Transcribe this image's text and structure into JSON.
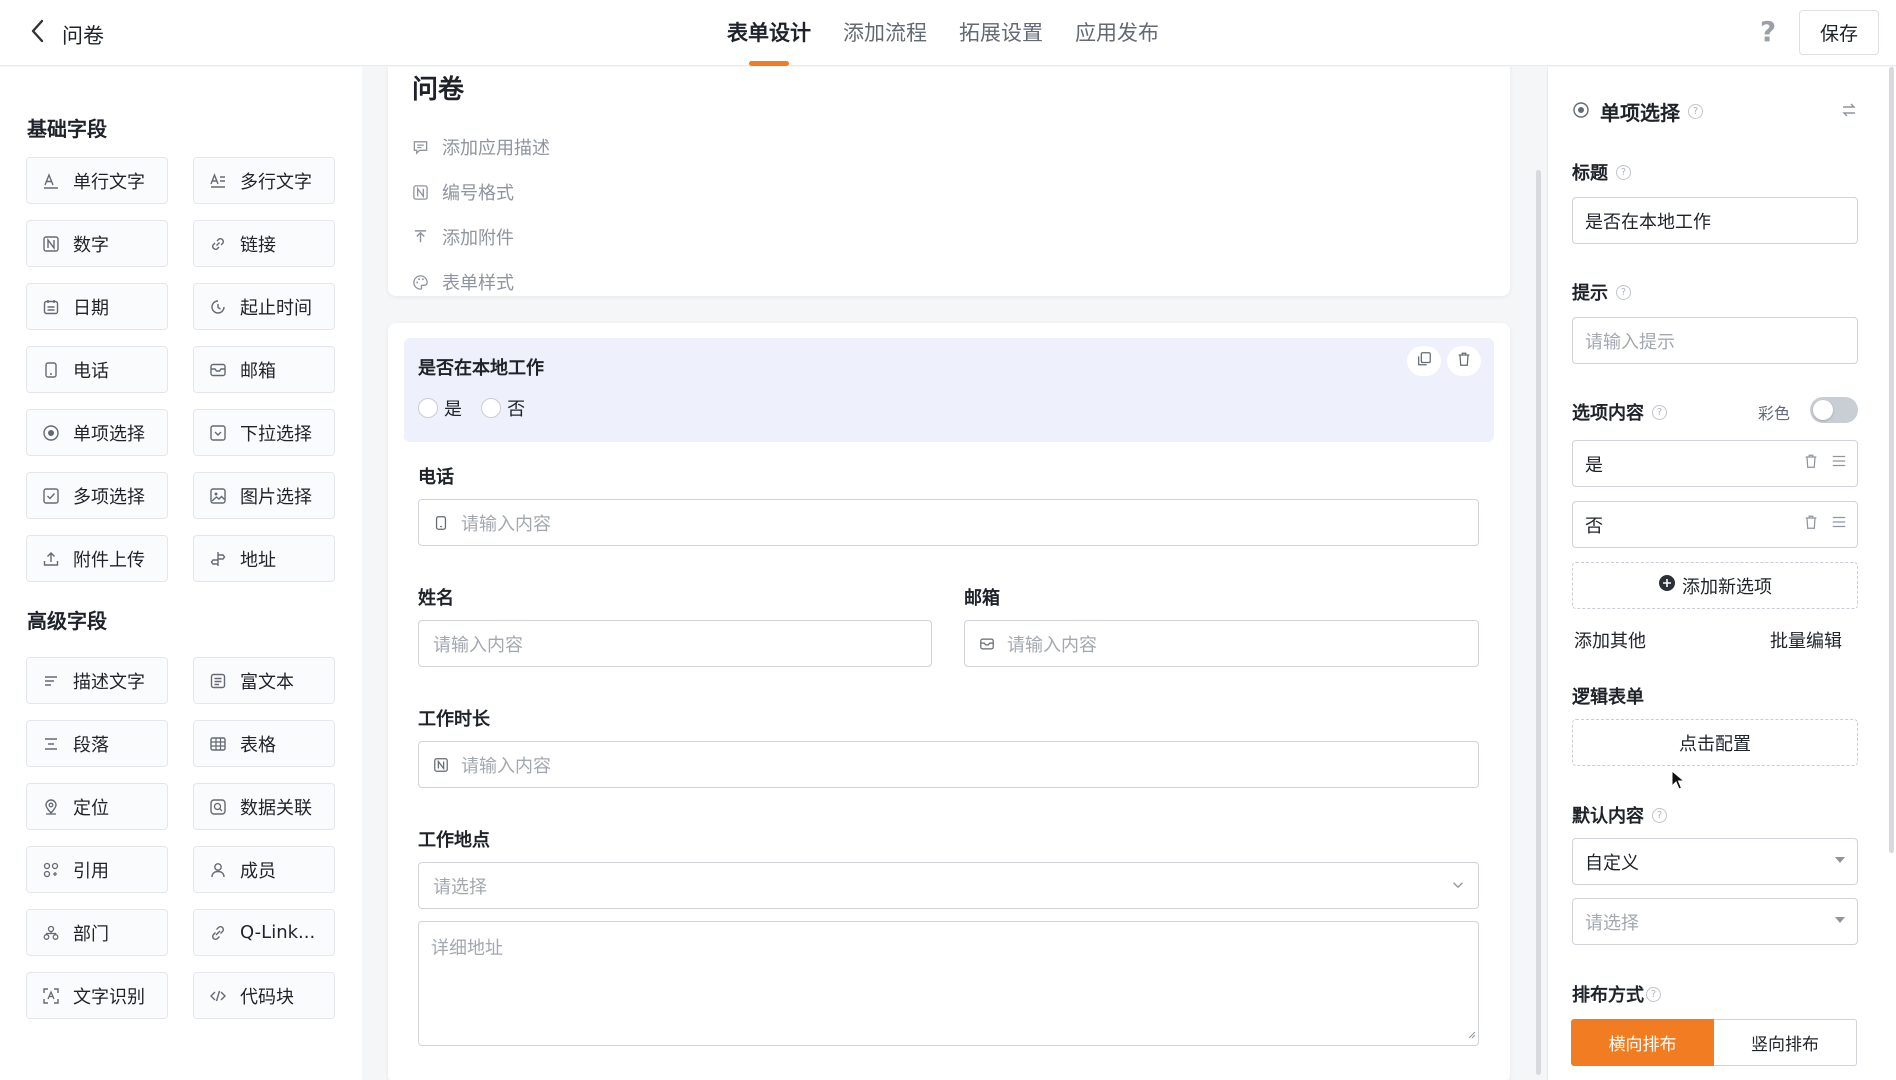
{
  "header": {
    "back_icon": "chevron-left-icon",
    "title": "问卷",
    "tabs": [
      {
        "label": "表单设计",
        "active": true
      },
      {
        "label": "添加流程",
        "active": false
      },
      {
        "label": "拓展设置",
        "active": false
      },
      {
        "label": "应用发布",
        "active": false
      }
    ],
    "help_label": "?",
    "save_label": "保存",
    "accent_color": "#f27c22"
  },
  "left_panel": {
    "basic_title": "基础字段",
    "basic_fields": [
      {
        "label": "单行文字",
        "icon": "text-line-icon"
      },
      {
        "label": "多行文字",
        "icon": "text-multi-icon"
      },
      {
        "label": "数字",
        "icon": "number-icon"
      },
      {
        "label": "链接",
        "icon": "link-icon"
      },
      {
        "label": "日期",
        "icon": "calendar-icon"
      },
      {
        "label": "起止时间",
        "icon": "time-range-icon"
      },
      {
        "label": "电话",
        "icon": "phone-icon"
      },
      {
        "label": "邮箱",
        "icon": "mail-icon"
      },
      {
        "label": "单项选择",
        "icon": "radio-icon"
      },
      {
        "label": "下拉选择",
        "icon": "dropdown-icon"
      },
      {
        "label": "多项选择",
        "icon": "checkbox-icon"
      },
      {
        "label": "图片选择",
        "icon": "image-icon"
      },
      {
        "label": "附件上传",
        "icon": "upload-icon"
      },
      {
        "label": "地址",
        "icon": "address-icon"
      }
    ],
    "advanced_title": "高级字段",
    "advanced_fields": [
      {
        "label": "描述文字",
        "icon": "description-icon"
      },
      {
        "label": "富文本",
        "icon": "rich-text-icon"
      },
      {
        "label": "段落",
        "icon": "paragraph-icon"
      },
      {
        "label": "表格",
        "icon": "table-icon"
      },
      {
        "label": "定位",
        "icon": "location-icon"
      },
      {
        "label": "数据关联",
        "icon": "data-link-icon"
      },
      {
        "label": "引用",
        "icon": "reference-icon"
      },
      {
        "label": "成员",
        "icon": "member-icon"
      },
      {
        "label": "部门",
        "icon": "department-icon"
      },
      {
        "label": "Q-Link...",
        "icon": "qlink-icon"
      },
      {
        "label": "文字识别",
        "icon": "ocr-icon"
      },
      {
        "label": "代码块",
        "icon": "code-icon"
      }
    ]
  },
  "canvas": {
    "form_name": "问卷",
    "meta_items": [
      {
        "label": "添加应用描述",
        "icon": "comment-icon"
      },
      {
        "label": "编号格式",
        "icon": "number-format-icon"
      },
      {
        "label": "添加附件",
        "icon": "attach-icon"
      },
      {
        "label": "表单样式",
        "icon": "palette-icon"
      }
    ],
    "selected_question": {
      "title": "是否在本地工作",
      "options": [
        "是",
        "否"
      ]
    },
    "phone": {
      "label": "电话",
      "placeholder": "请输入内容"
    },
    "name": {
      "label": "姓名",
      "placeholder": "请输入内容"
    },
    "email": {
      "label": "邮箱",
      "placeholder": "请输入内容"
    },
    "work_duration": {
      "label": "工作时长",
      "placeholder": "请输入内容"
    },
    "work_location": {
      "label": "工作地点",
      "select_placeholder": "请选择",
      "detail_placeholder": "详细地址"
    }
  },
  "right_panel": {
    "component_name": "单项选择",
    "title_label": "标题",
    "title_value": "是否在本地工作",
    "hint_label": "提示",
    "hint_placeholder": "请输入提示",
    "options_label": "选项内容",
    "color_label": "彩色",
    "color_enabled": false,
    "options": [
      "是",
      "否"
    ],
    "add_option_label": "添加新选项",
    "add_other_label": "添加其他",
    "bulk_edit_label": "批量编辑",
    "logic_label": "逻辑表单",
    "logic_button": "点击配置",
    "default_label": "默认内容",
    "default_mode": "自定义",
    "default_placeholder": "请选择",
    "layout_label": "排布方式",
    "layout_horizontal": "横向排布",
    "layout_vertical": "竖向排布",
    "layout_selected": "横向排布"
  }
}
